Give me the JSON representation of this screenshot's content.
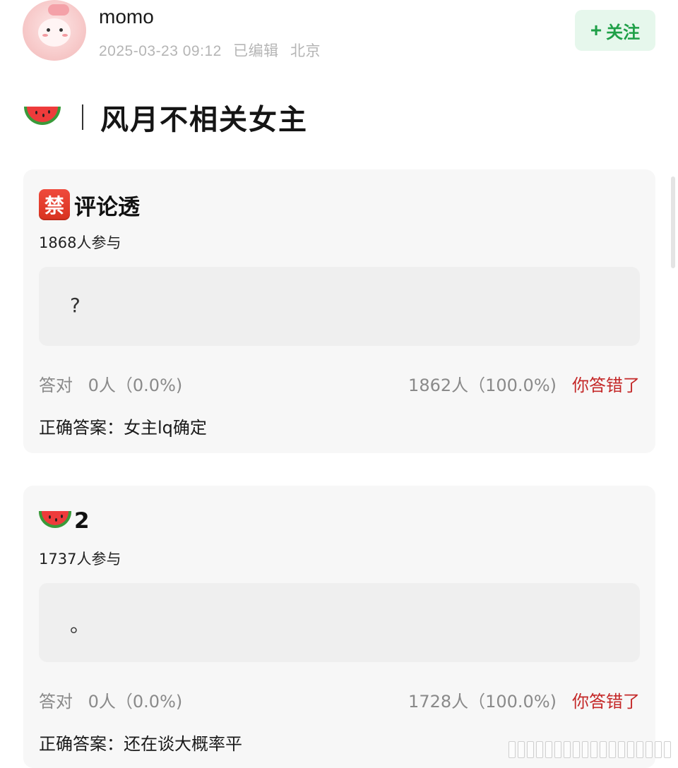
{
  "header": {
    "username": "momo",
    "timestamp": "2025-03-23 09:12",
    "edited_label": "已编辑",
    "location": "北京",
    "follow_plus": "+",
    "follow_label": "关注"
  },
  "title": {
    "separator": "|",
    "text": "风月不相关女主"
  },
  "quizzes": [
    {
      "badge": "禁",
      "title": "评论透",
      "participants": "1868人参与",
      "answer": "?",
      "correct_label": "答对",
      "correct_stat": "0人（0.0%)",
      "wrong_stat": "1862人（100.0%)",
      "wrong_label": "你答错了",
      "answer_label": "正确答案：",
      "answer_value": "女主lq确定"
    },
    {
      "title": "2",
      "participants": "1737人参与",
      "answer": "。",
      "correct_label": "答对",
      "correct_stat": "0人（0.0%)",
      "wrong_stat": "1728人（100.0%)",
      "wrong_label": "你答错了",
      "answer_label": "正确答案：",
      "answer_value": "还在谈大概率平"
    }
  ],
  "colors": {
    "accent_green": "#1fa048",
    "wrong_red": "#c42828",
    "card_bg": "#f7f7f7"
  },
  "icons": [
    "avatar-image",
    "watermelon-icon",
    "ban-icon"
  ]
}
